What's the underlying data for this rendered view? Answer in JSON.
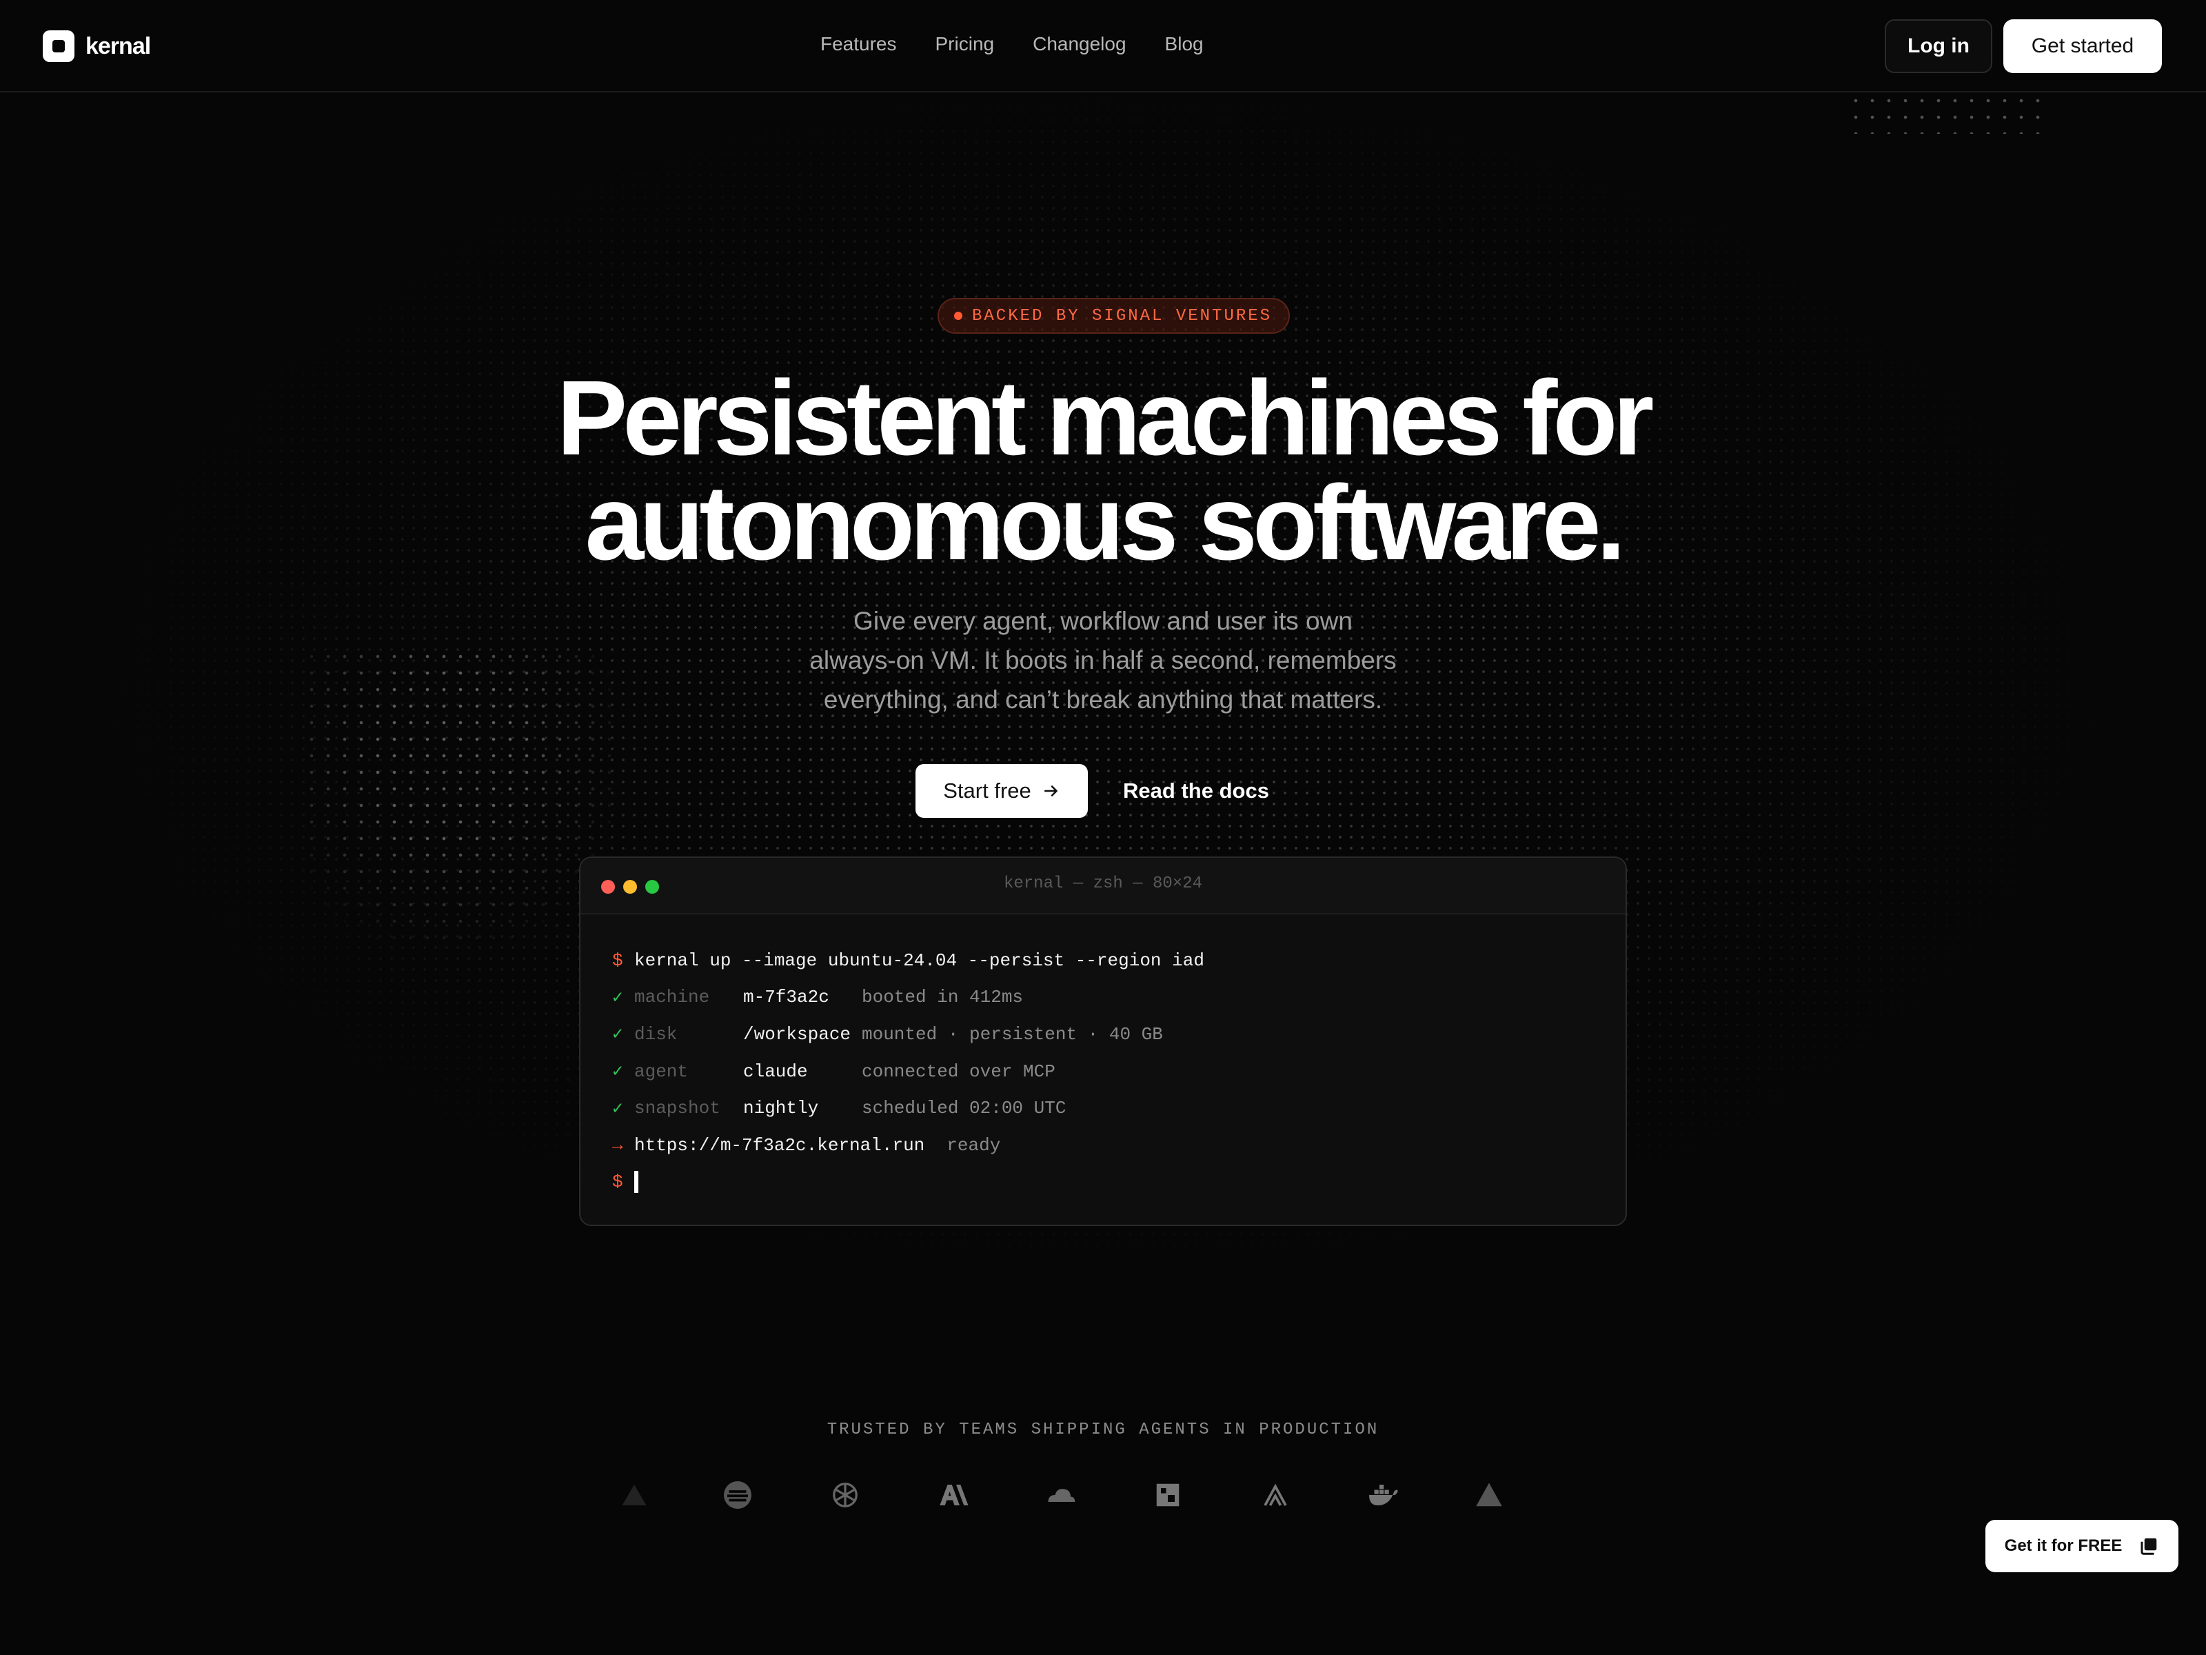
{
  "brand": {
    "name": "kernal"
  },
  "nav": {
    "links": [
      "Features",
      "Pricing",
      "Changelog",
      "Blog"
    ],
    "login": "Log in",
    "get_started": "Get started"
  },
  "hero": {
    "badge": "BACKED BY SIGNAL VENTURES",
    "title_line1": "Persistent machines for",
    "title_line2": "autonomous software.",
    "subtitle_lines": [
      "Give every agent, workflow and user its own",
      "always-on VM. It boots in half a second, remembers",
      "everything, and can’t break anything that matters."
    ],
    "start_free": "Start free",
    "read_docs": "Read the docs"
  },
  "terminal": {
    "title": "kernal — zsh — 80×24",
    "prompt_symbol": "$",
    "check_symbol": "✓",
    "arrow_symbol": "→",
    "command": "kernal up --image ubuntu-24.04 --persist --region iad",
    "rows": [
      {
        "key": "machine",
        "value": "m-7f3a2c",
        "desc": "booted in 412ms"
      },
      {
        "key": "disk",
        "value": "/workspace",
        "desc": "mounted · persistent · 40 GB"
      },
      {
        "key": "agent",
        "value": "claude",
        "desc": "connected over MCP"
      },
      {
        "key": "snapshot",
        "value": "nightly",
        "desc": "scheduled 02:00 UTC"
      }
    ],
    "url": "https://m-7f3a2c.kernal.run",
    "url_status": "ready"
  },
  "trusted": {
    "label": "TRUSTED BY TEAMS SHIPPING AGENTS IN PRODUCTION",
    "logos": [
      "vercel-logo",
      "stripe-logo",
      "openai-logo",
      "anthropic-logo",
      "cloudflare-logo",
      "figma-logo",
      "netlify-logo",
      "docker-logo",
      "triangle-logo"
    ]
  },
  "cta_float": {
    "label": "Get it for FREE"
  },
  "colors": {
    "accent": "#ff5a34",
    "success": "#35c35a",
    "background": "#060606"
  }
}
